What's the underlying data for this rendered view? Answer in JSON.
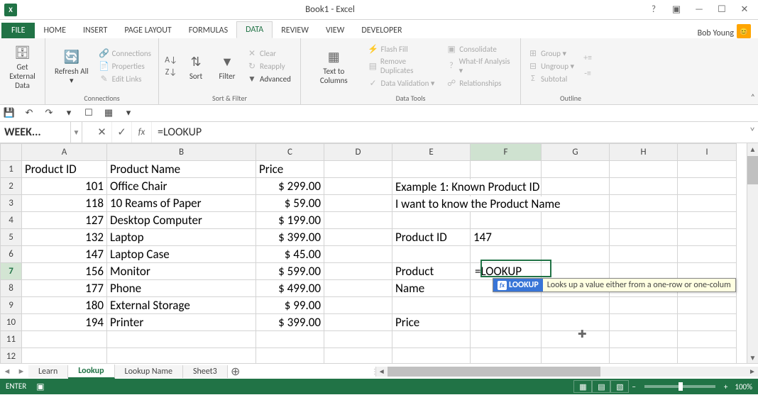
{
  "title": "Book1 - Excel",
  "user": "Bob Young",
  "tabs": {
    "file": "FILE",
    "items": [
      "HOME",
      "INSERT",
      "PAGE LAYOUT",
      "FORMULAS",
      "DATA",
      "REVIEW",
      "VIEW",
      "DEVELOPER"
    ],
    "active": 4
  },
  "ribbon": {
    "groups": {
      "get_data": {
        "label": "Get External Data ▾",
        "big": "Get External\nData"
      },
      "connections": {
        "label": "Connections",
        "refresh": "Refresh All ▾",
        "conn": "Connections",
        "prop": "Properties",
        "links": "Edit Links"
      },
      "sortfilter": {
        "label": "Sort & Filter",
        "sort": "Sort",
        "filter": "Filter",
        "clear": "Clear",
        "reapply": "Reapply",
        "advanced": "Advanced"
      },
      "datatools": {
        "label": "Data Tools",
        "t2c": "Text to Columns",
        "flash": "Flash Fill",
        "remdup": "Remove Duplicates",
        "dataval": "Data Validation ▾",
        "consol": "Consolidate",
        "whatif": "What-If Analysis ▾",
        "rel": "Relationships"
      },
      "outline": {
        "label": "Outline",
        "group": "Group ▾",
        "ungroup": "Ungroup ▾",
        "subtotal": "Subtotal"
      }
    }
  },
  "name_box": "WEEK...",
  "formula": "=LOOKUP",
  "columns": [
    "A",
    "B",
    "C",
    "D",
    "E",
    "F",
    "G",
    "H",
    "I"
  ],
  "rows": [
    {
      "n": 1,
      "A": "Product ID",
      "B": "Product Name",
      "C": "Price",
      "E": "",
      "F": ""
    },
    {
      "n": 2,
      "A": "101",
      "B": "Office Chair",
      "C": "$ 299.00",
      "E": "Example 1: Known Product ID"
    },
    {
      "n": 3,
      "A": "118",
      "B": "10 Reams of Paper",
      "C": "$   59.00",
      "E": "I want to know the Product Name"
    },
    {
      "n": 4,
      "A": "127",
      "B": "Desktop Computer",
      "C": "$ 199.00"
    },
    {
      "n": 5,
      "A": "132",
      "B": "Laptop",
      "C": "$ 399.00",
      "E": "Product ID",
      "F": "147"
    },
    {
      "n": 6,
      "A": "147",
      "B": "Laptop Case",
      "C": "$   45.00"
    },
    {
      "n": 7,
      "A": "156",
      "B": "Monitor",
      "C": "$ 599.00",
      "E": "Product",
      "F": "=LOOKUP"
    },
    {
      "n": 8,
      "A": "177",
      "B": "Phone",
      "C": "$ 499.00",
      "E": "Name"
    },
    {
      "n": 9,
      "A": "180",
      "B": "External Storage",
      "C": "$   99.00"
    },
    {
      "n": 10,
      "A": "194",
      "B": "Printer",
      "C": "$ 399.00",
      "E": "Price"
    },
    {
      "n": 11
    },
    {
      "n": 12
    }
  ],
  "active_row": 7,
  "active_col": "F",
  "tooltip": {
    "name": "LOOKUP",
    "desc": "Looks up a value either from a one-row or one-colum"
  },
  "sheet_tabs": [
    "Learn",
    "Lookup",
    "Lookup Name",
    "Sheet3"
  ],
  "active_sheet": 1,
  "status": {
    "mode": "ENTER",
    "zoom": "100%"
  }
}
